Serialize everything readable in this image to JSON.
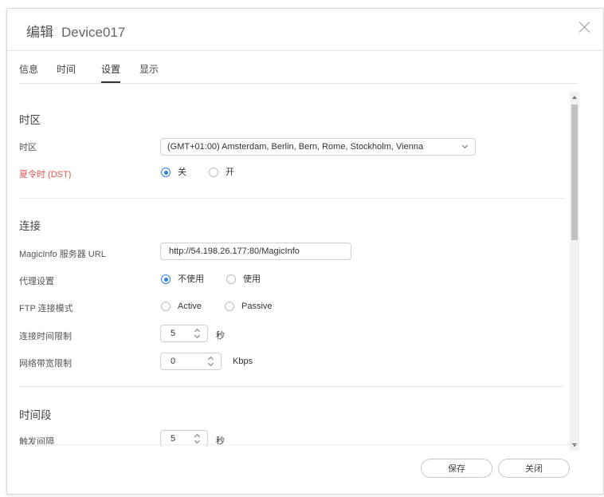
{
  "dialog": {
    "title_prefix": "编辑",
    "device_name": "Device017"
  },
  "tabs": [
    "信息",
    "时间",
    "设置",
    "显示"
  ],
  "active_tab": "设置",
  "timezone_section": {
    "title": "时区",
    "timezone_label": "时区",
    "timezone_value": "(GMT+01:00) Amsterdam, Berlin, Bern, Rome, Stockholm, Vienna",
    "dst_label": "夏令时 (DST)",
    "dst_options": [
      "关",
      "开"
    ],
    "dst_selected": "关"
  },
  "connection_section": {
    "title": "连接",
    "url_label": "MagicInfo 服务器 URL",
    "url_value": "http://54.198.26.177:80/MagicInfo",
    "proxy_label": "代理设置",
    "proxy_options": [
      "不使用",
      "使用"
    ],
    "proxy_selected": "不使用",
    "ftp_label": "FTP 连接模式",
    "ftp_options": [
      "Active",
      "Passive"
    ],
    "timeout_label": "连接时间限制",
    "timeout_value": "5",
    "timeout_unit": "秒",
    "bandwidth_label": "网络带宽限制",
    "bandwidth_value": "0",
    "bandwidth_unit": "Kbps"
  },
  "timeslot_section": {
    "title": "时间段",
    "trigger_label": "触发间隔",
    "trigger_value": "5",
    "trigger_unit": "秒"
  },
  "buttons": {
    "save": "保存",
    "close": "关闭"
  },
  "colors": {
    "accent": "#2f80ed",
    "dst_label": "#e0544b"
  }
}
